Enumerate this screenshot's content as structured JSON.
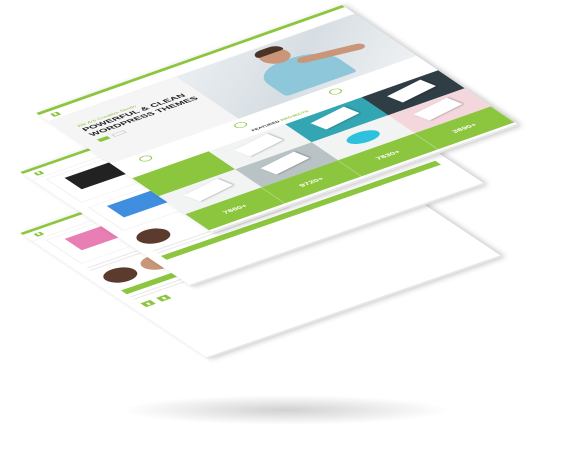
{
  "hero": {
    "subtitle": "We Are Creative Studio",
    "title_line1": "POWERFUL & CLEAN",
    "title_line2": "WORDPRESS THEMES"
  },
  "features_title_prefix": "FEATURED",
  "features_title_highlight": "PROJECTS",
  "stats": [
    {
      "value": "7860+"
    },
    {
      "value": "9720+"
    },
    {
      "value": "7830+"
    },
    {
      "value": "3890+"
    }
  ],
  "brand": {
    "accent": "#8cc63e",
    "accent_dark": "#6aa82a",
    "teal": "#33a6b4"
  },
  "icons": [
    "logo-icon",
    "feature-icon",
    "arrow-icon"
  ]
}
